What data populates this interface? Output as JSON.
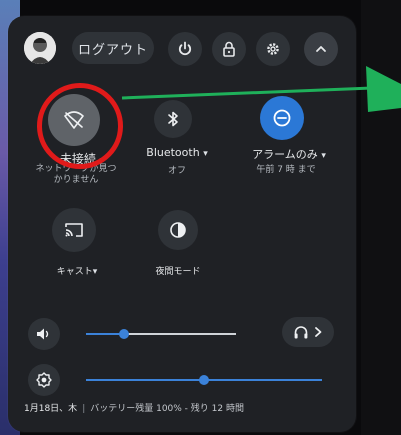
{
  "colors": {
    "panel_bg": "#1f2125",
    "accent_blue": "#2b78d6",
    "slider_blue": "#3b82d9",
    "annotation_red": "#e01a1a",
    "annotation_green": "#1fb05a"
  },
  "header": {
    "avatar_icon": "user-avatar",
    "logout_label": "ログアウト",
    "power_icon": "power-icon",
    "lock_icon": "lock-icon",
    "settings_icon": "gear-icon",
    "collapse_icon": "chevron-up-icon"
  },
  "tiles": {
    "wifi": {
      "icon": "wifi-off-icon",
      "label": "未接続",
      "sub": "ネットワークが見つかりません"
    },
    "bluetooth": {
      "icon": "bluetooth-icon",
      "label": "Bluetooth",
      "sub": "オフ"
    },
    "alarm": {
      "icon": "do-not-disturb-icon",
      "label": "アラームのみ",
      "sub": "午前 7 時 まで"
    },
    "cast": {
      "icon": "cast-icon",
      "label": "キャスト"
    },
    "dark_mode": {
      "icon": "dark-mode-icon",
      "label": "夜間モード"
    }
  },
  "sliders": {
    "volume": {
      "icon": "volume-icon",
      "level": 0.25
    },
    "brightness": {
      "icon": "brightness-icon",
      "level": 0.5
    },
    "audio_settings_icon": "headphones-icon"
  },
  "footer": {
    "date": "1月18日、木",
    "battery": "バッテリー残量 100% - 残り 12 時間"
  }
}
